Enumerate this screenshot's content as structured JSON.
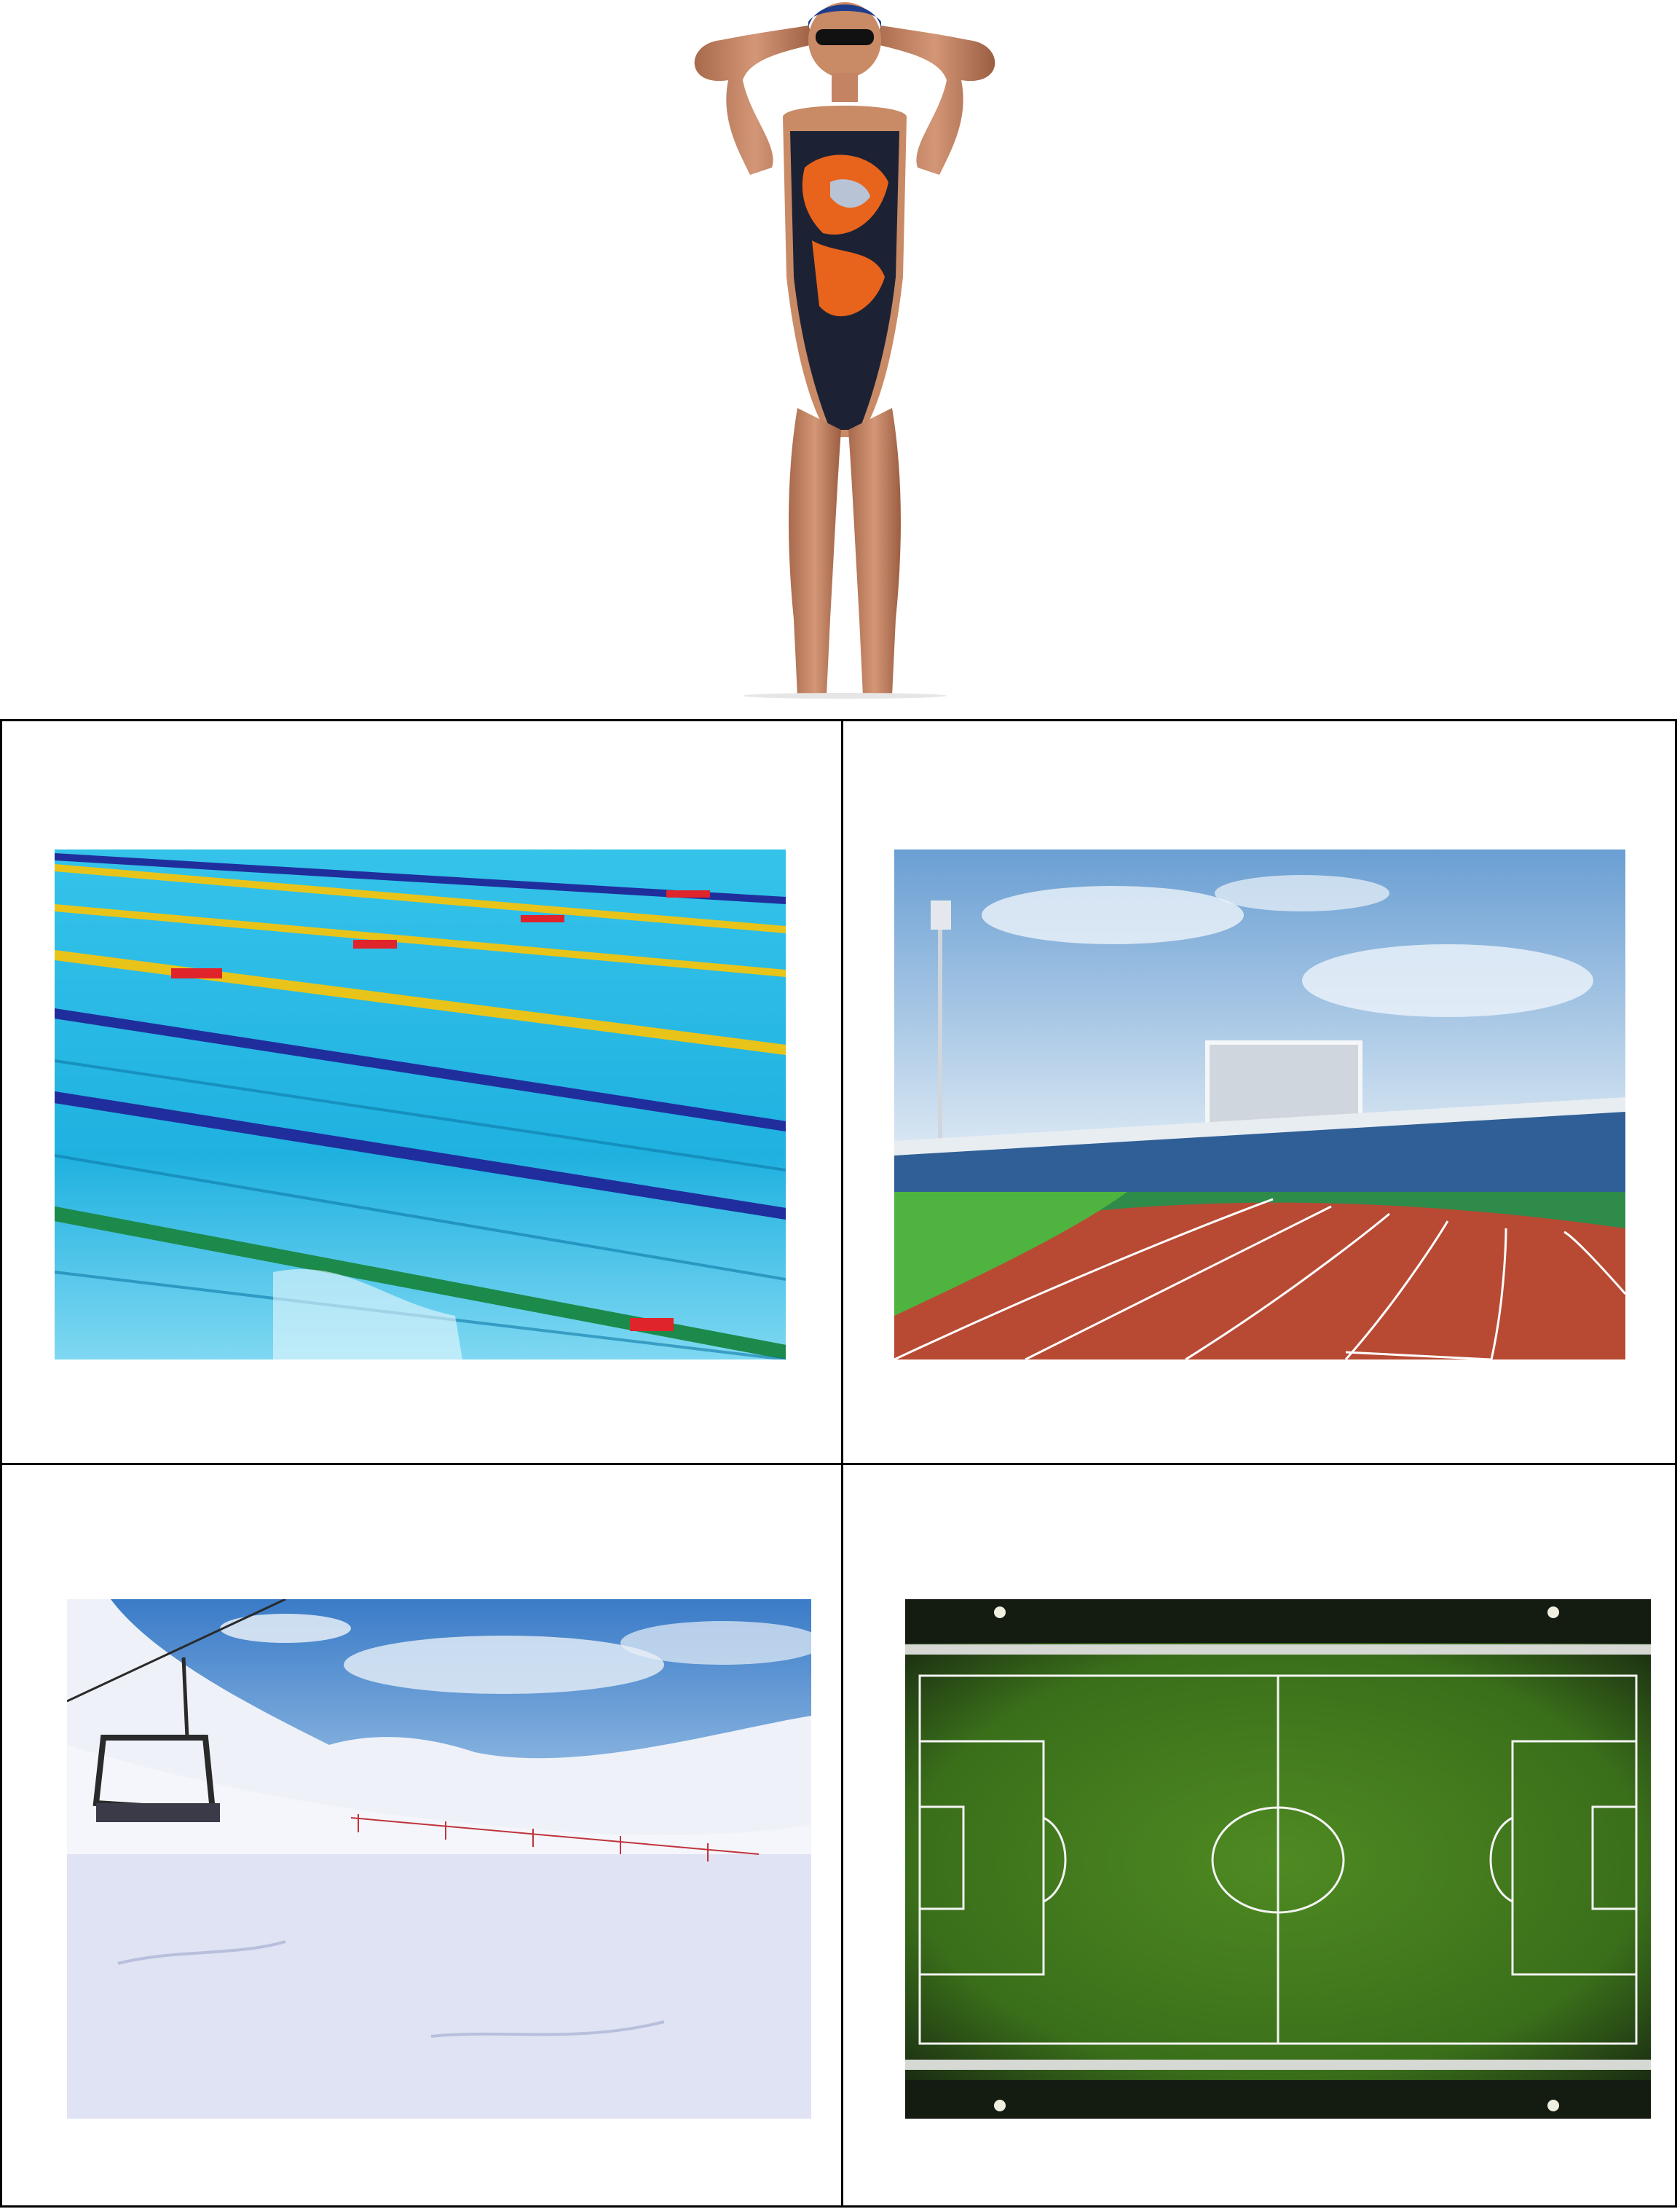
{
  "document": {
    "top_image": {
      "name": "swimmer",
      "icon": "swimmer-photo",
      "colors": {
        "suit": "#1c2233",
        "accent": "#e8641c",
        "skin": "#c98a66"
      }
    },
    "grid": {
      "rows": 2,
      "cols": 2,
      "cells": [
        {
          "name": "swimming-pool",
          "icon": "pool-photo"
        },
        {
          "name": "running-track",
          "icon": "track-photo"
        },
        {
          "name": "ski-slope",
          "icon": "ski-photo"
        },
        {
          "name": "soccer-field",
          "icon": "field-photo"
        }
      ]
    }
  }
}
